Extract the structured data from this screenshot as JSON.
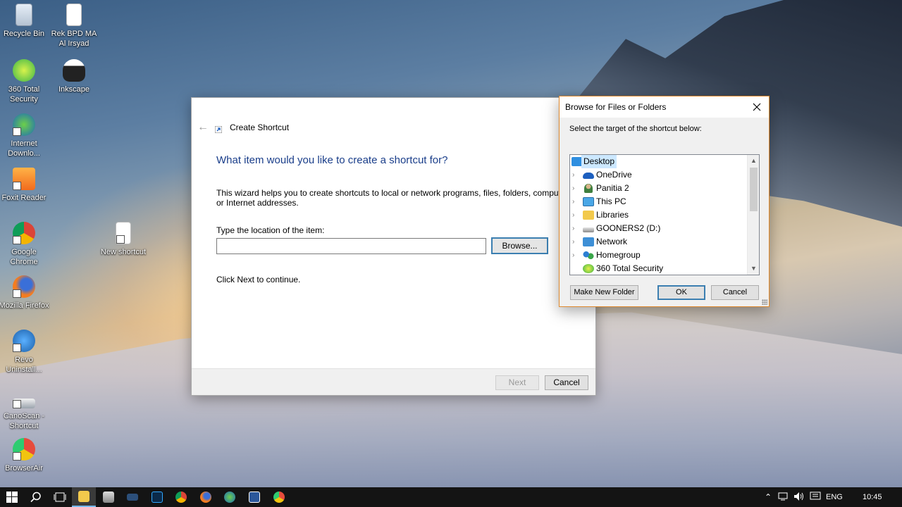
{
  "desktop": {
    "icons": [
      {
        "label": "Recycle Bin"
      },
      {
        "label": "Rek BPD MA Al Irsyad"
      },
      {
        "label": "360 Total Security"
      },
      {
        "label": "Inkscape"
      },
      {
        "label": "Internet Downlo..."
      },
      {
        "label": "Foxit Reader"
      },
      {
        "label": "Google Chrome"
      },
      {
        "label": "New shortcut"
      },
      {
        "label": "Mozilla Firefox"
      },
      {
        "label": "Revo Uninstall..."
      },
      {
        "label": "CanoScan - Shortcut"
      },
      {
        "label": "BrowserAir"
      }
    ]
  },
  "wizard": {
    "title": "Create Shortcut",
    "heading": "What item would you like to create a shortcut for?",
    "description": "This wizard helps you to create shortcuts to local or network programs, files, folders, computers or Internet addresses.",
    "location_label": "Type the location of the item:",
    "location_value": "",
    "browse_label": "Browse...",
    "continue_note": "Click Next to continue.",
    "next_label": "Next",
    "cancel_label": "Cancel"
  },
  "browse_dialog": {
    "title": "Browse for Files or Folders",
    "prompt": "Select the target of the shortcut below:",
    "tree": [
      {
        "label": "Desktop",
        "icon": "desktop-icon",
        "selected": true
      },
      {
        "label": "OneDrive",
        "icon": "cloud-icon"
      },
      {
        "label": "Panitia 2",
        "icon": "user-icon"
      },
      {
        "label": "This PC",
        "icon": "computer-icon"
      },
      {
        "label": "Libraries",
        "icon": "folder-icon"
      },
      {
        "label": "GOONERS2 (D:)",
        "icon": "drive-icon"
      },
      {
        "label": "Network",
        "icon": "network-icon"
      },
      {
        "label": "Homegroup",
        "icon": "homegroup-icon"
      },
      {
        "label": "360 Total Security",
        "icon": "shield-icon"
      }
    ],
    "new_folder_label": "Make New Folder",
    "ok_label": "OK",
    "cancel_label": "Cancel"
  },
  "taskbar": {
    "language": "ENG",
    "time": "10:45"
  },
  "colors": {
    "heading_blue": "#1a3e8a",
    "selection": "#cce8ff",
    "dialog_border": "#e08a2e",
    "taskbar": "#141414"
  }
}
